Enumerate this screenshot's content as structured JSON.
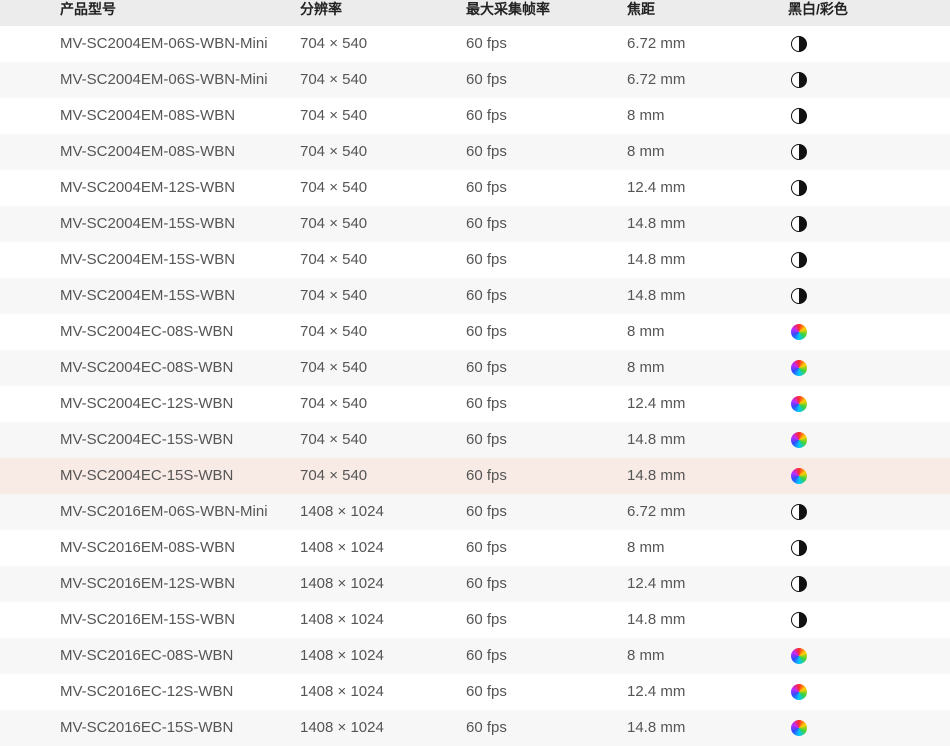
{
  "table": {
    "headers": {
      "model": "产品型号",
      "resolution": "分辨率",
      "fps": "最大采集帧率",
      "focal": "焦距",
      "color": "黑白/彩色"
    },
    "rows": [
      {
        "model": "MV-SC2004EM-06S-WBN-Mini",
        "resolution": "704 × 540",
        "fps": "60 fps",
        "focal": "6.72 mm",
        "color_icon": "mono-icon"
      },
      {
        "model": "MV-SC2004EM-06S-WBN-Mini",
        "resolution": "704 × 540",
        "fps": "60 fps",
        "focal": "6.72 mm",
        "color_icon": "mono-icon"
      },
      {
        "model": "MV-SC2004EM-08S-WBN",
        "resolution": "704 × 540",
        "fps": "60 fps",
        "focal": "8 mm",
        "color_icon": "mono-icon"
      },
      {
        "model": "MV-SC2004EM-08S-WBN",
        "resolution": "704 × 540",
        "fps": "60 fps",
        "focal": "8 mm",
        "color_icon": "mono-icon"
      },
      {
        "model": "MV-SC2004EM-12S-WBN",
        "resolution": "704 × 540",
        "fps": "60 fps",
        "focal": "12.4 mm",
        "color_icon": "mono-icon"
      },
      {
        "model": "MV-SC2004EM-15S-WBN",
        "resolution": "704 × 540",
        "fps": "60 fps",
        "focal": "14.8 mm",
        "color_icon": "mono-icon"
      },
      {
        "model": "MV-SC2004EM-15S-WBN",
        "resolution": "704 × 540",
        "fps": "60 fps",
        "focal": "14.8 mm",
        "color_icon": "mono-icon"
      },
      {
        "model": "MV-SC2004EM-15S-WBN",
        "resolution": "704 × 540",
        "fps": "60 fps",
        "focal": "14.8 mm",
        "color_icon": "mono-icon"
      },
      {
        "model": "MV-SC2004EC-08S-WBN",
        "resolution": "704 × 540",
        "fps": "60 fps",
        "focal": "8 mm",
        "color_icon": "color-wheel-icon"
      },
      {
        "model": "MV-SC2004EC-08S-WBN",
        "resolution": "704 × 540",
        "fps": "60 fps",
        "focal": "8 mm",
        "color_icon": "color-wheel-icon"
      },
      {
        "model": "MV-SC2004EC-12S-WBN",
        "resolution": "704 × 540",
        "fps": "60 fps",
        "focal": "12.4 mm",
        "color_icon": "color-wheel-icon"
      },
      {
        "model": "MV-SC2004EC-15S-WBN",
        "resolution": "704 × 540",
        "fps": "60 fps",
        "focal": "14.8 mm",
        "color_icon": "color-wheel-icon"
      },
      {
        "model": "MV-SC2004EC-15S-WBN",
        "resolution": "704 × 540",
        "fps": "60 fps",
        "focal": "14.8 mm",
        "color_icon": "color-wheel-icon",
        "hovered": true
      },
      {
        "model": "MV-SC2016EM-06S-WBN-Mini",
        "resolution": "1408 × 1024",
        "fps": "60 fps",
        "focal": "6.72 mm",
        "color_icon": "mono-icon"
      },
      {
        "model": "MV-SC2016EM-08S-WBN",
        "resolution": "1408 × 1024",
        "fps": "60 fps",
        "focal": "8 mm",
        "color_icon": "mono-icon"
      },
      {
        "model": "MV-SC2016EM-12S-WBN",
        "resolution": "1408 × 1024",
        "fps": "60 fps",
        "focal": "12.4 mm",
        "color_icon": "mono-icon"
      },
      {
        "model": "MV-SC2016EM-15S-WBN",
        "resolution": "1408 × 1024",
        "fps": "60 fps",
        "focal": "14.8 mm",
        "color_icon": "mono-icon"
      },
      {
        "model": "MV-SC2016EC-08S-WBN",
        "resolution": "1408 × 1024",
        "fps": "60 fps",
        "focal": "8 mm",
        "color_icon": "color-wheel-icon"
      },
      {
        "model": "MV-SC2016EC-12S-WBN",
        "resolution": "1408 × 1024",
        "fps": "60 fps",
        "focal": "12.4 mm",
        "color_icon": "color-wheel-icon"
      },
      {
        "model": "MV-SC2016EC-15S-WBN",
        "resolution": "1408 × 1024",
        "fps": "60 fps",
        "focal": "14.8 mm",
        "color_icon": "color-wheel-icon"
      }
    ]
  },
  "colors": {
    "header_bg": "#ececec",
    "row_alt_bg": "#f7f7f7",
    "row_hover_bg": "#f8ebe6",
    "text": "#555555"
  }
}
